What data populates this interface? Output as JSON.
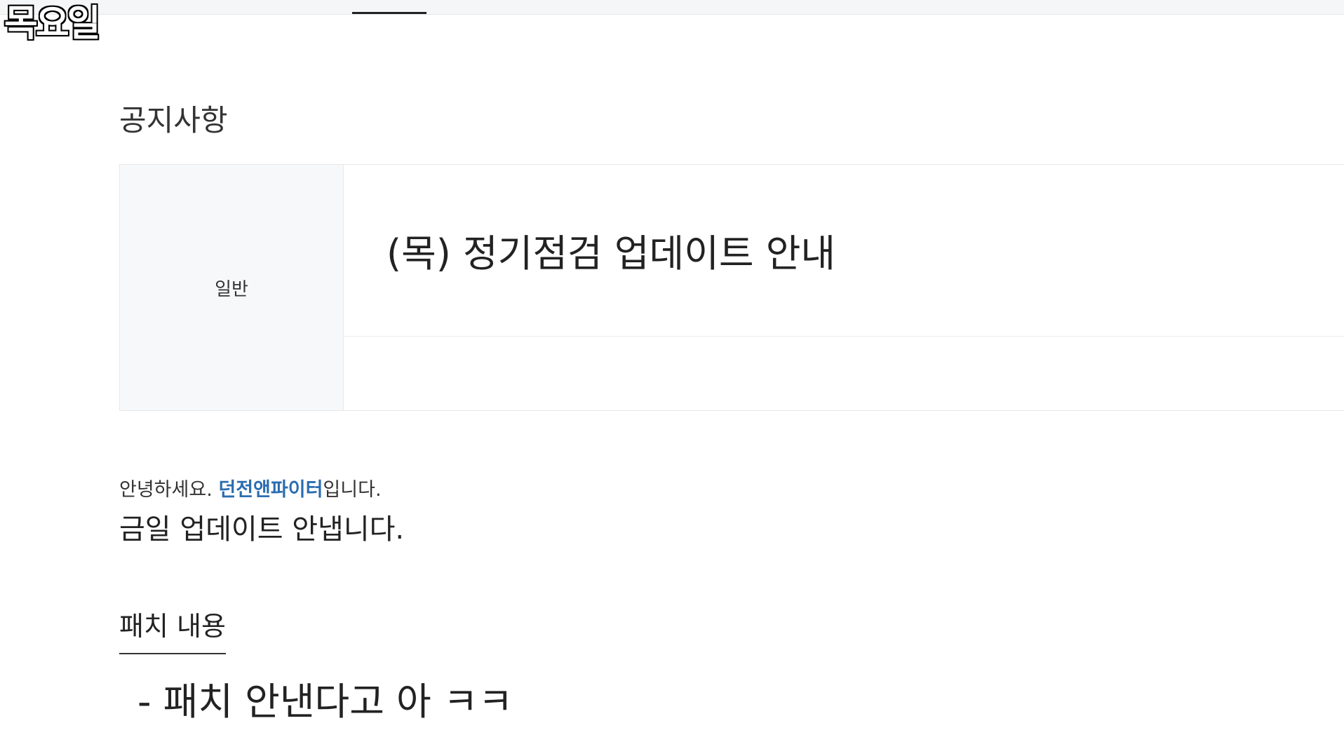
{
  "overlay": {
    "day_label": "목요일"
  },
  "notice": {
    "section_title": "공지사항",
    "category": "일반",
    "title": "(목) 정기점검 업데이트 안내"
  },
  "body": {
    "greeting_prefix": "안녕하세요. ",
    "greeting_link": "던전앤파이터",
    "greeting_suffix": "입니다.",
    "update_line": "금일 업데이트 안냅니다.",
    "patch_heading": "패치 내용",
    "patch_item": "- 패치 안낸다고 아 ㅋㅋ"
  },
  "colors": {
    "link": "#2b6cb0",
    "category_bg": "#f7f8fa"
  }
}
